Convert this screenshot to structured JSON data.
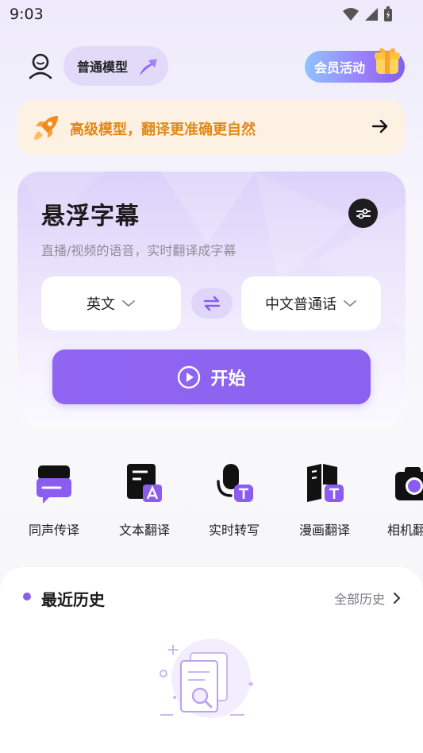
{
  "status_bar": {
    "time": "9:03",
    "icons": [
      "wifi-icon",
      "signal-icon",
      "battery-icon"
    ]
  },
  "header": {
    "user_icon": "user-icon",
    "model_label": "普通模型",
    "model_icon": "upgrade-arrow-icon",
    "vip_label": "会员活动",
    "vip_icon": "gift-icon"
  },
  "banner": {
    "icon": "rocket-icon",
    "text": "高级模型，翻译更准确更自然",
    "arrow_icon": "arrow-right-icon"
  },
  "main_card": {
    "title": "悬浮字幕",
    "subtitle": "直播/视频的语音，实时翻译成字幕",
    "settings_icon": "settings-sliders-icon",
    "source_language": "英文",
    "target_language": "中文普通话",
    "swap_icon": "swap-icon",
    "start_label": "开始",
    "start_icon": "play-circle-icon"
  },
  "tools": [
    {
      "label": "同声传译",
      "icon": "simultaneous-interpretation-icon"
    },
    {
      "label": "文本翻译",
      "icon": "text-translate-icon"
    },
    {
      "label": "实时转写",
      "icon": "realtime-transcribe-icon"
    },
    {
      "label": "漫画翻译",
      "icon": "comic-translate-icon"
    },
    {
      "label": "相机翻",
      "icon": "camera-translate-icon"
    }
  ],
  "history": {
    "title": "最近历史",
    "all_label": "全部历史",
    "empty_icon": "empty-history-illustration"
  },
  "colors": {
    "accent": "#8b62ef",
    "banner_bg": "#fdf1e3",
    "banner_text": "#e08a16"
  }
}
